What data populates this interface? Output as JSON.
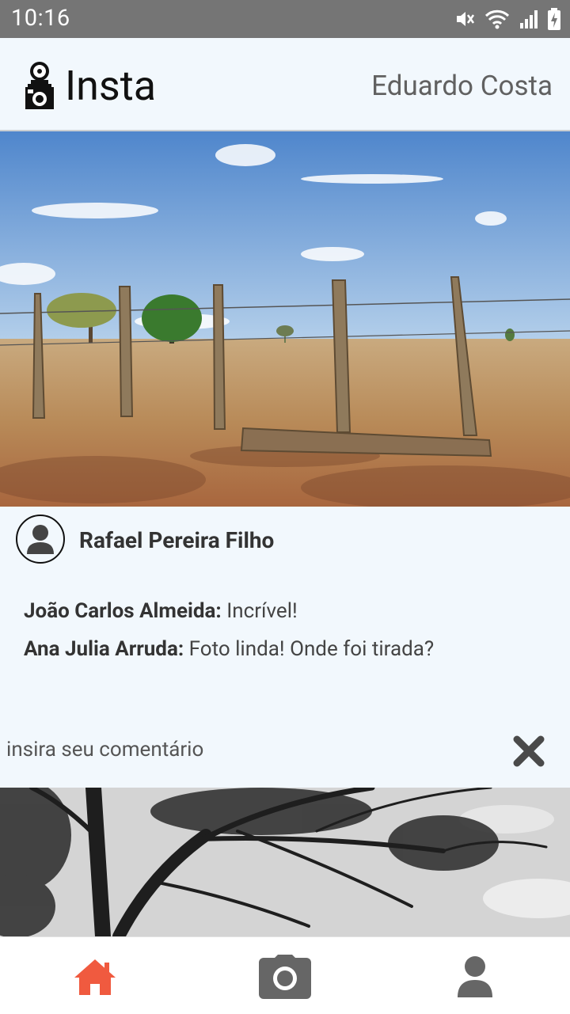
{
  "status_bar": {
    "time": "10:16"
  },
  "header": {
    "app_title": "Insta",
    "user_name": "Eduardo Costa"
  },
  "post": {
    "author": "Rafael Pereira Filho",
    "comments": [
      {
        "author": "João Carlos Almeida:",
        "text": "Incrível!"
      },
      {
        "author": "Ana Julia Arruda:",
        "text": "Foto linda! Onde foi tirada?"
      }
    ],
    "comment_placeholder": "insira seu comentário"
  },
  "bottom_nav": {
    "items": [
      {
        "name": "home-icon",
        "active": true
      },
      {
        "name": "camera-icon",
        "active": false
      },
      {
        "name": "profile-icon",
        "active": false
      }
    ]
  },
  "colors": {
    "background": "#f2f8fd",
    "status_bar": "#757575",
    "active_nav": "#f05a3f",
    "inactive_nav": "#666666"
  }
}
